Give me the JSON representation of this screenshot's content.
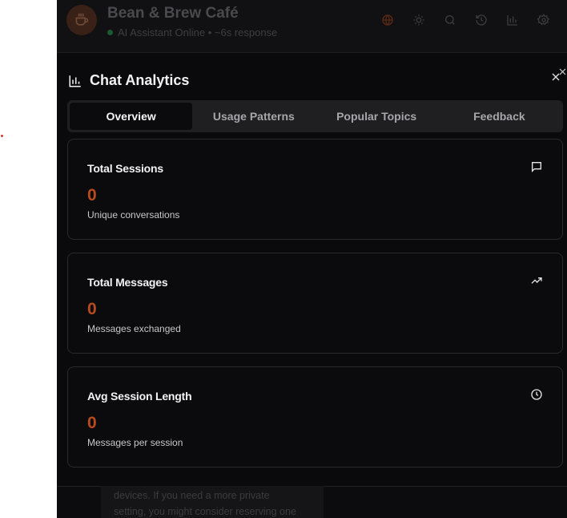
{
  "header": {
    "cafe_name": "Bean & Brew Café",
    "status_text": "AI Assistant Online • ~6s response",
    "icons": [
      "globe-icon",
      "sun-icon",
      "search-icon",
      "history-icon",
      "bar-chart-icon",
      "gear-icon"
    ]
  },
  "background_chat": {
    "line1": "devices. If you need a more private",
    "line2": "setting, you might consider reserving one"
  },
  "analytics": {
    "title": "Chat Analytics",
    "tabs": [
      "Overview",
      "Usage Patterns",
      "Popular Topics",
      "Feedback"
    ],
    "active_tab": "Overview",
    "cards": [
      {
        "title": "Total Sessions",
        "value": "0",
        "subtitle": "Unique conversations",
        "icon": "message-square-icon"
      },
      {
        "title": "Total Messages",
        "value": "0",
        "subtitle": "Messages exchanged",
        "icon": "trending-up-icon"
      },
      {
        "title": "Avg Session Length",
        "value": "0",
        "subtitle": "Messages per session",
        "icon": "clock-icon"
      }
    ]
  },
  "colors": {
    "accent": "#b84a1e",
    "background": "#0a0a0c",
    "status_online": "#1a5a2e"
  }
}
